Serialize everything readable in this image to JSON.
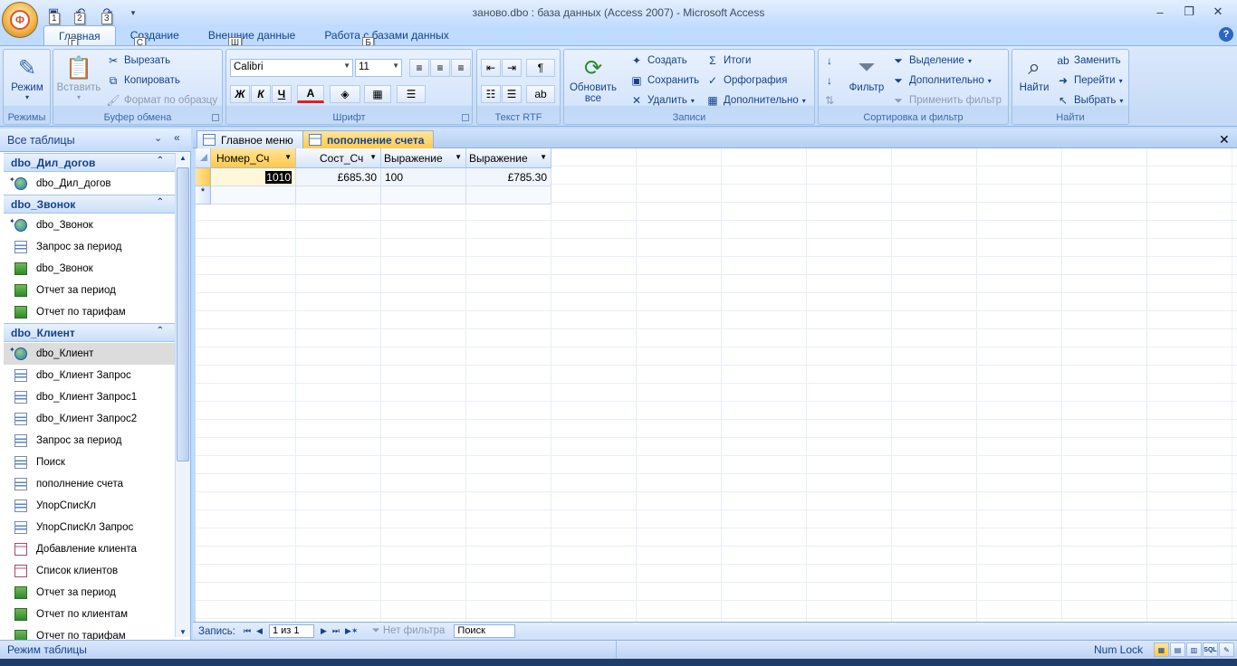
{
  "window": {
    "title": "заново.dbo : база данных (Access 2007)  -  Microsoft Access",
    "office_logo": "Ф",
    "qat_keytips": [
      "1",
      "2",
      "3"
    ],
    "controls": [
      "‒",
      "❐",
      "✕"
    ]
  },
  "ribbon_tabs": [
    {
      "label": "Главная",
      "keytip": "Г"
    },
    {
      "label": "Создание",
      "keytip": "С"
    },
    {
      "label": "Внешние данные",
      "keytip": "Ш"
    },
    {
      "label": "Работа с базами данных",
      "keytip": "Б"
    }
  ],
  "ribbon": {
    "modes": {
      "label": "Режимы",
      "button": "Режим"
    },
    "clipboard": {
      "label": "Буфер обмена",
      "paste": "Вставить",
      "cut": "Вырезать",
      "copy": "Копировать",
      "format_painter": "Формат по образцу"
    },
    "font": {
      "label": "Шрифт",
      "family": "Calibri",
      "size": "11",
      "bold": "Ж",
      "italic": "К",
      "underline": "Ч",
      "color": "A"
    },
    "rtf": {
      "label": "Текст RTF"
    },
    "records": {
      "label": "Записи",
      "refresh": "Обновить",
      "refresh2": "все",
      "new": "Создать",
      "save": "Сохранить",
      "delete": "Удалить",
      "totals": "Итоги",
      "spelling": "Орфография",
      "more": "Дополнительно"
    },
    "sortfilter": {
      "label": "Сортировка и фильтр",
      "filter": "Фильтр",
      "selection": "Выделение",
      "advanced": "Дополнительно",
      "apply": "Применить фильтр"
    },
    "find": {
      "label": "Найти",
      "find": "Найти",
      "replace": "Заменить",
      "goto": "Перейти",
      "select": "Выбрать"
    }
  },
  "nav": {
    "header": "Все таблицы",
    "groups": [
      {
        "title": "dbo_Дил_догов",
        "items": [
          {
            "label": "dbo_Дил_догов",
            "type": "table",
            "pinned": true
          }
        ]
      },
      {
        "title": "dbo_Звонок",
        "items": [
          {
            "label": "dbo_Звонок",
            "type": "table",
            "pinned": true
          },
          {
            "label": "Запрос за период",
            "type": "query"
          },
          {
            "label": "dbo_Звонок",
            "type": "report"
          },
          {
            "label": "Отчет за период",
            "type": "report"
          },
          {
            "label": "Отчет по тарифам",
            "type": "report"
          }
        ]
      },
      {
        "title": "dbo_Клиент",
        "items": [
          {
            "label": "dbo_Клиент",
            "type": "table",
            "pinned": true,
            "selected": true
          },
          {
            "label": "dbo_Клиент Запрос",
            "type": "query"
          },
          {
            "label": "dbo_Клиент Запрос1",
            "type": "query"
          },
          {
            "label": "dbo_Клиент Запрос2",
            "type": "query"
          },
          {
            "label": "Запрос за период",
            "type": "query"
          },
          {
            "label": "Поиск",
            "type": "query"
          },
          {
            "label": "пополнение счета",
            "type": "query"
          },
          {
            "label": "УпорСписКл",
            "type": "query"
          },
          {
            "label": "УпорСписКл Запрос",
            "type": "query"
          },
          {
            "label": "Добавление клиента",
            "type": "form"
          },
          {
            "label": "Список клиентов",
            "type": "form"
          },
          {
            "label": "Отчет за период",
            "type": "report"
          },
          {
            "label": "Отчет по клиентам",
            "type": "report"
          },
          {
            "label": "Отчет по тарифам",
            "type": "report"
          }
        ]
      }
    ]
  },
  "doc_tabs": [
    {
      "label": "Главное меню",
      "active": false
    },
    {
      "label": "пополнение счета",
      "active": true
    }
  ],
  "grid": {
    "columns": [
      "Номер_Сч",
      "Сост_Сч",
      "Выражение",
      "Выражение"
    ],
    "row": [
      "1010",
      "£685.30",
      "100",
      "£785.30"
    ],
    "new_row_marker": "*"
  },
  "record_nav": {
    "label": "Запись:",
    "position": "1 из 1",
    "filter": "Нет фильтра",
    "search": "Поиск"
  },
  "status": {
    "mode": "Режим таблицы",
    "numlock": "Num Lock",
    "sql": "SQL"
  }
}
